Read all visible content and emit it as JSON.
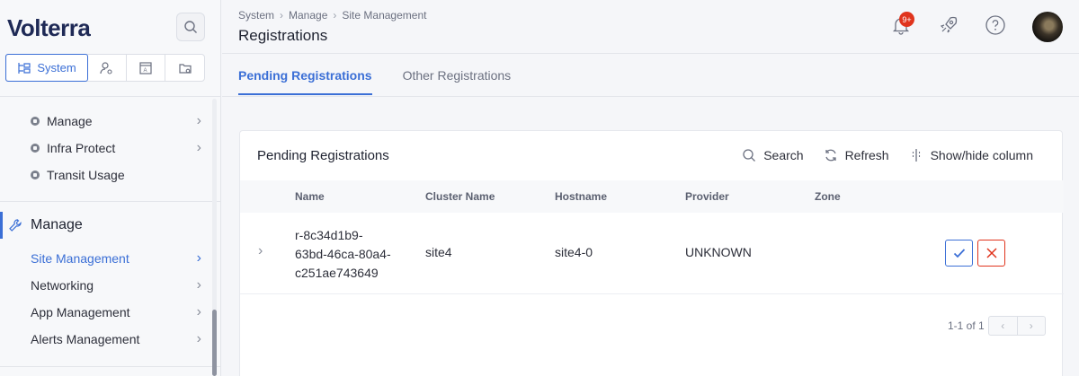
{
  "sidebar": {
    "logo": "Volterra",
    "workspace_tabs": [
      {
        "label": "System",
        "icon": "tree-icon"
      },
      {
        "label": "",
        "icon": "user-settings-icon"
      },
      {
        "label": "",
        "icon": "app-icon"
      },
      {
        "label": "",
        "icon": "folder-settings-icon"
      }
    ],
    "sub_items": [
      {
        "label": "Manage"
      },
      {
        "label": "Infra Protect"
      },
      {
        "label": "Transit Usage"
      }
    ],
    "section_title": "Manage",
    "items": [
      {
        "label": "Site Management"
      },
      {
        "label": "Networking"
      },
      {
        "label": "App Management"
      },
      {
        "label": "Alerts Management"
      }
    ]
  },
  "header": {
    "breadcrumb": [
      "System",
      "Manage",
      "Site Management"
    ],
    "title": "Registrations",
    "notification_badge": "9+"
  },
  "tabs": [
    {
      "label": "Pending Registrations"
    },
    {
      "label": "Other Registrations"
    }
  ],
  "card": {
    "title": "Pending Registrations",
    "actions": {
      "search": "Search",
      "refresh": "Refresh",
      "columns": "Show/hide column"
    },
    "columns": [
      "Name",
      "Cluster Name",
      "Hostname",
      "Provider",
      "Zone"
    ],
    "rows": [
      {
        "name_lines": [
          "r-8c34d1b9-",
          "63bd-46ca-80a4-",
          "c251ae743649"
        ],
        "cluster": "site4",
        "hostname": "site4-0",
        "provider": "UNKNOWN",
        "zone": ""
      }
    ],
    "pagination": "1-1 of 1"
  },
  "colors": {
    "accent": "#3b6fd6",
    "danger": "#e0341d"
  }
}
